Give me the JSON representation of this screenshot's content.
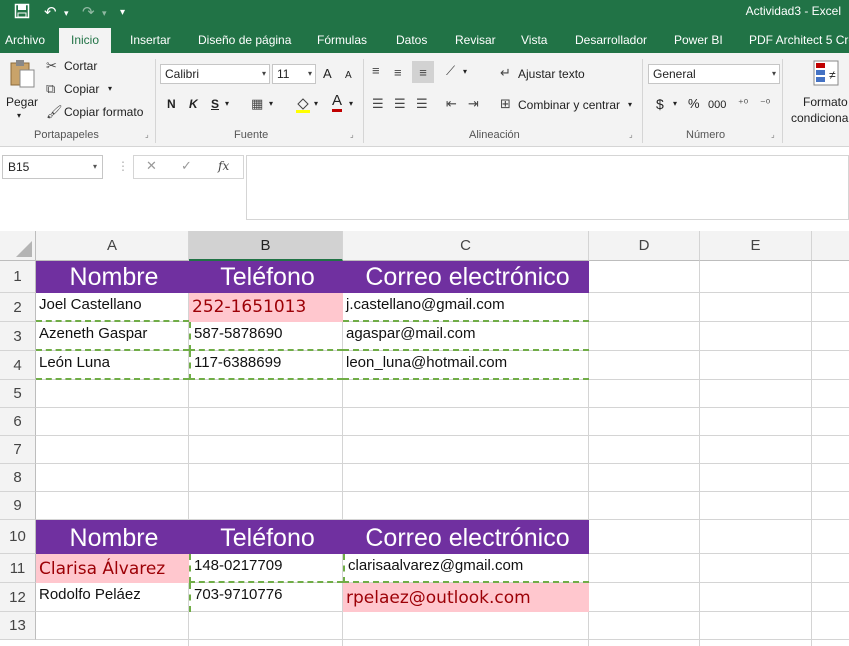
{
  "window": {
    "title": "Actividad3 - Excel",
    "undo_glyph": "↶",
    "redo_glyph": "↷",
    "save_glyph": "💾",
    "customize_glyph": "▾"
  },
  "tabs": [
    {
      "label": "Archivo"
    },
    {
      "label": "Inicio"
    },
    {
      "label": "Insertar"
    },
    {
      "label": "Diseño de página"
    },
    {
      "label": "Fórmulas"
    },
    {
      "label": "Datos"
    },
    {
      "label": "Revisar"
    },
    {
      "label": "Vista"
    },
    {
      "label": "Desarrollador"
    },
    {
      "label": "Power BI"
    },
    {
      "label": "PDF Architect 5 Cre"
    }
  ],
  "ribbon": {
    "clipboard": {
      "paste": "Pegar",
      "cut": "Cortar",
      "copy": "Copiar",
      "format_painter": "Copiar formato",
      "label": "Portapapeles"
    },
    "font": {
      "family": "Calibri",
      "size": "11",
      "grow": "A",
      "shrink": "A",
      "bold": "N",
      "italic": "K",
      "underline": "S",
      "font_color_glyph": "A",
      "label": "Fuente"
    },
    "alignment": {
      "wrap": "Ajustar texto",
      "merge": "Combinar y centrar",
      "label": "Alineación"
    },
    "number": {
      "format": "General",
      "currency": "$",
      "percent": "%",
      "thousands": "000",
      "label": "Número"
    },
    "styles": {
      "conditional_line1": "Formato",
      "conditional_line2": "condicional"
    }
  },
  "formula_bar": {
    "name_box": "B15",
    "fx": "fx",
    "cancel": "✕",
    "enter": "✓",
    "content": ""
  },
  "grid": {
    "columns": [
      "A",
      "B",
      "C",
      "D",
      "E"
    ],
    "selected_column": "B",
    "rows": [
      "1",
      "2",
      "3",
      "4",
      "5",
      "6",
      "7",
      "8",
      "9",
      "10",
      "11",
      "12",
      "13"
    ],
    "table1": {
      "headers": [
        "Nombre",
        "Teléfono",
        "Correo electrónico"
      ],
      "rows": [
        [
          "Joel Castellano",
          "252-1651013",
          "j.castellano@gmail.com"
        ],
        [
          "Azeneth Gaspar",
          "587-5878690",
          "agaspar@mail.com"
        ],
        [
          "León Luna",
          "117-6388699",
          "leon_luna@hotmail.com"
        ]
      ]
    },
    "table2": {
      "headers": [
        "Nombre",
        "Teléfono",
        "Correo electrónico"
      ],
      "rows": [
        [
          "Clarisa Álvarez",
          "148-0217709",
          "clarisaalvarez@gmail.com"
        ],
        [
          "Rodolfo Peláez",
          "703-9710776",
          "rpelaez@outlook.com"
        ]
      ]
    },
    "colors": {
      "header_fill": "#7030a0",
      "highlight_fill": "#ffc7ce",
      "highlight_text": "#9c0006",
      "copy_marquee": "#70ad47"
    }
  }
}
